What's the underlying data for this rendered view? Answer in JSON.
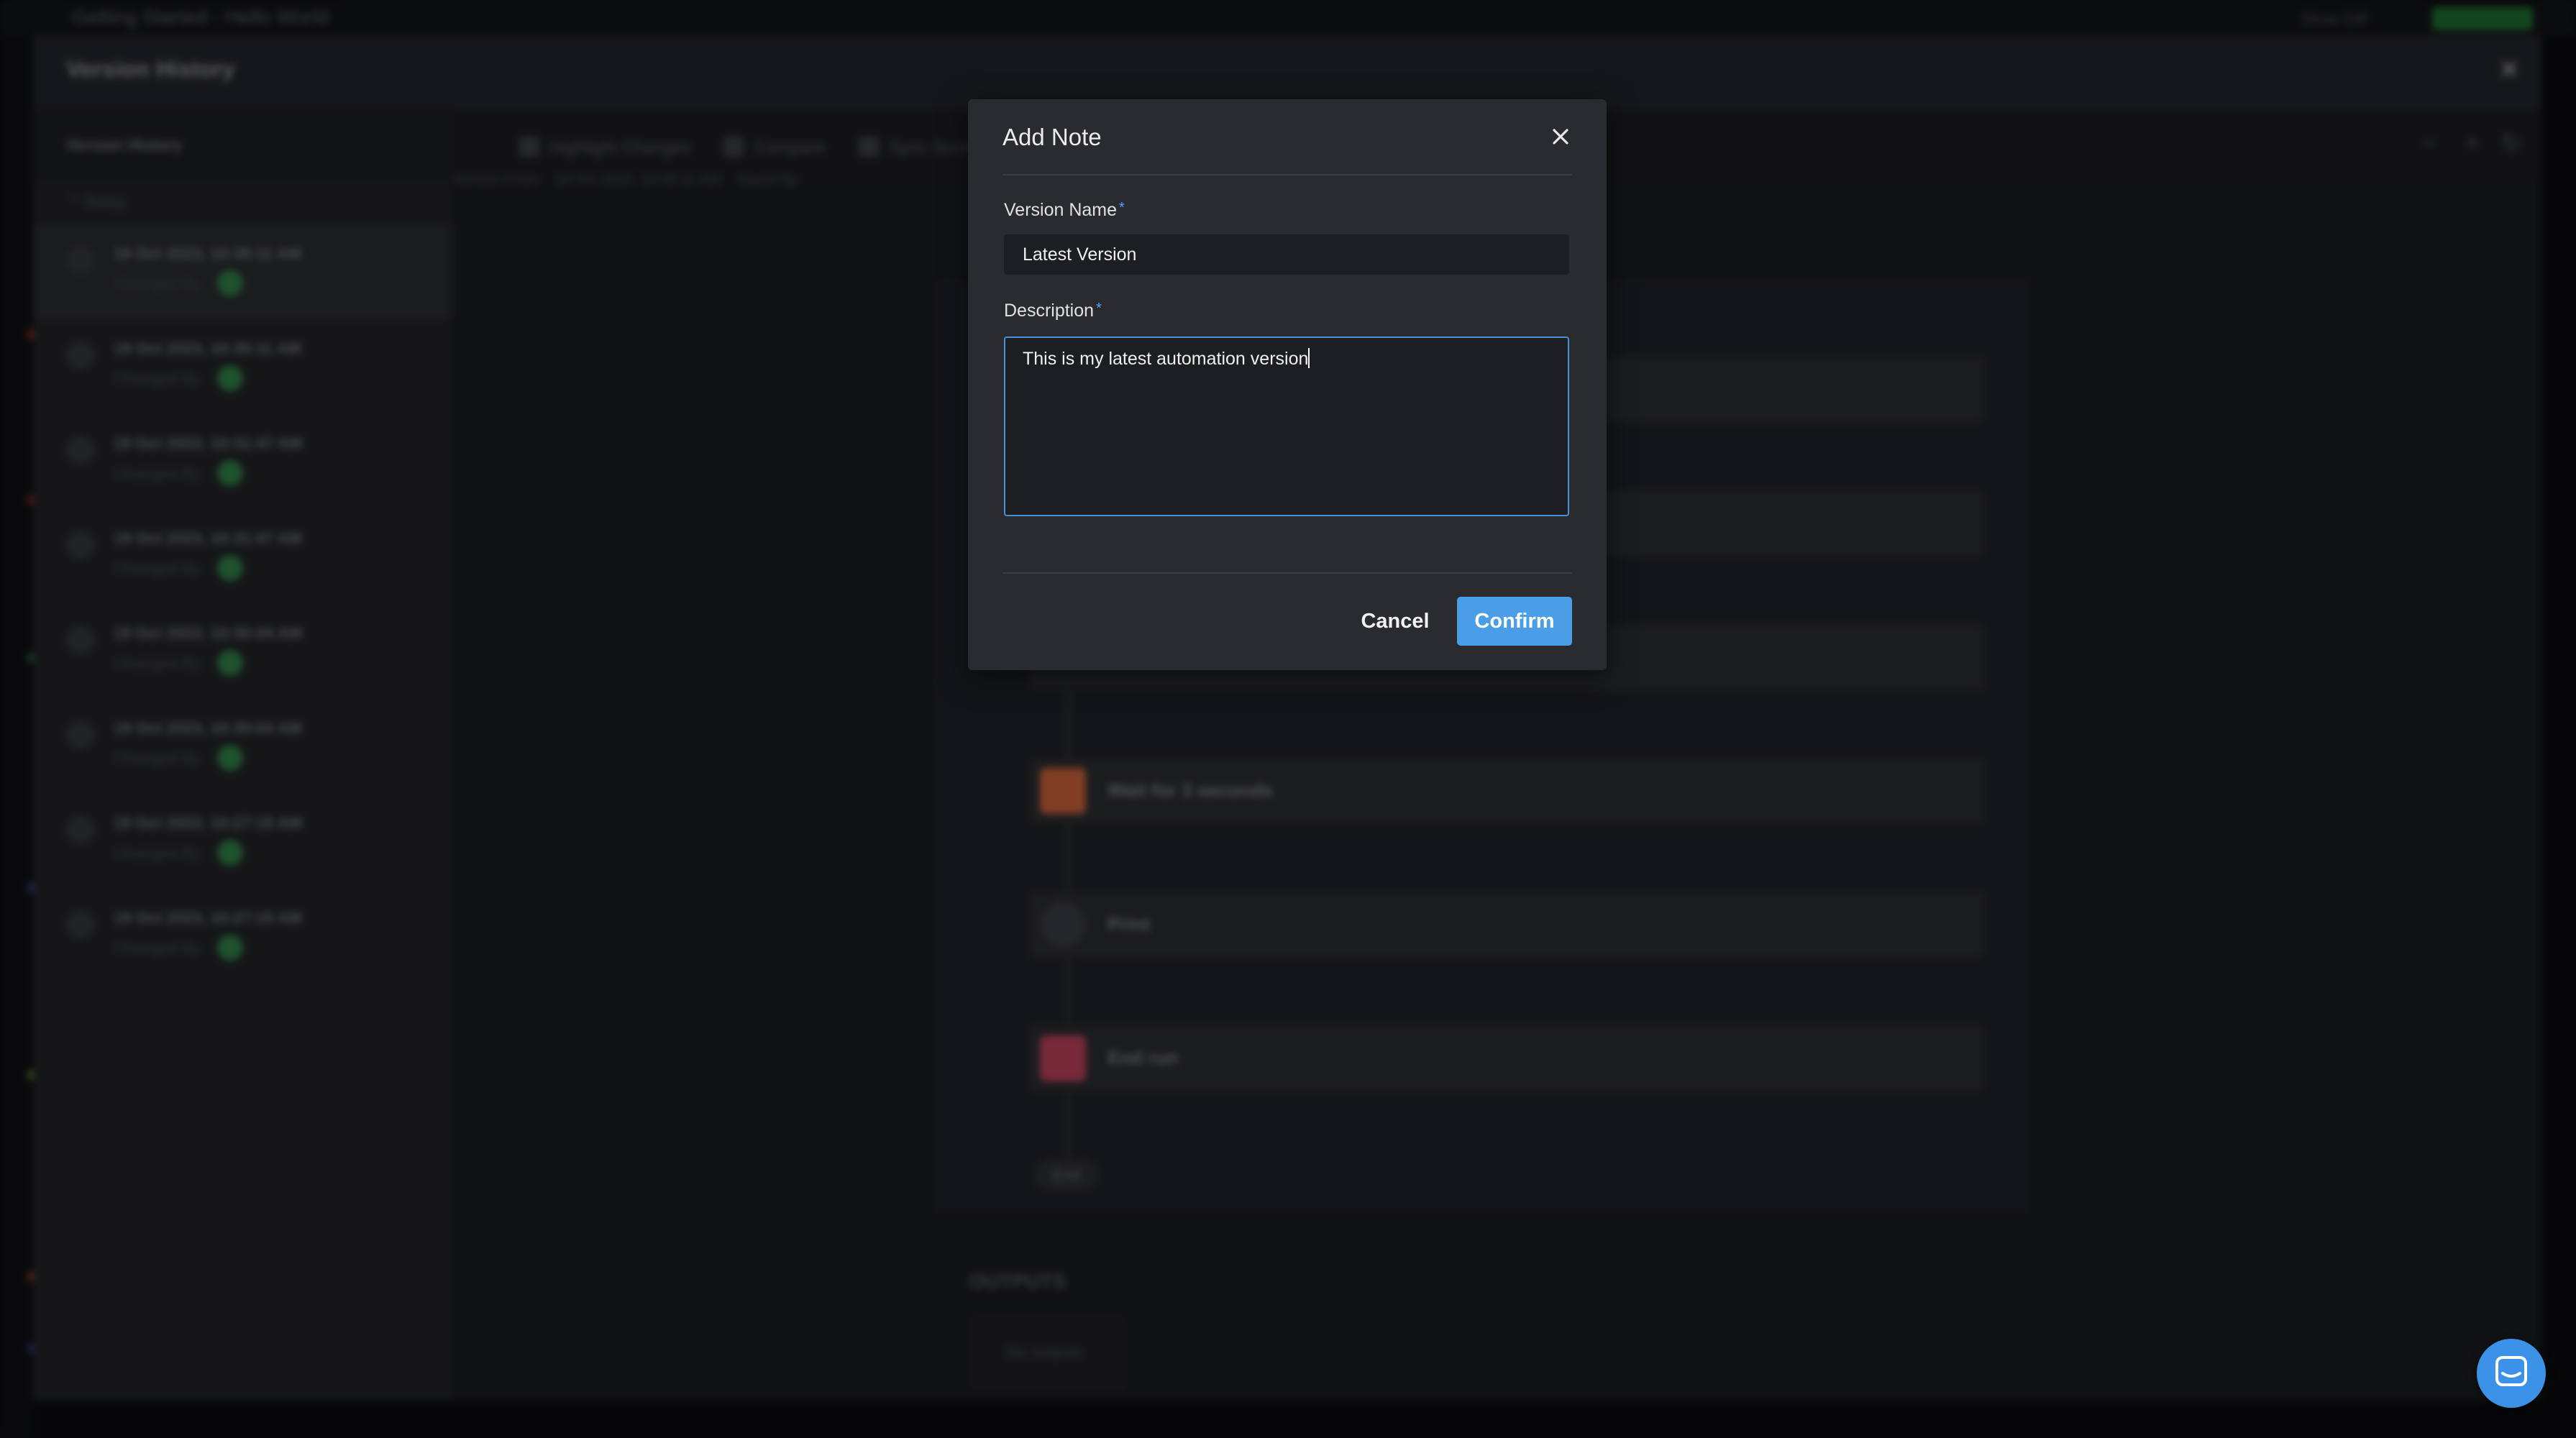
{
  "background": {
    "app_title": "Getting Started - Hello World",
    "top_right_text": "Show Diff",
    "panel_title": "Version History",
    "sidebar_header": "Version History",
    "today_label": "Today",
    "versions": [
      {
        "date": "19 Oct 2023, 10:35:11 AM",
        "changed_by": "Changed By"
      },
      {
        "date": "19 Oct 2023, 10:35:11 AM",
        "changed_by": "Changed By"
      },
      {
        "date": "19 Oct 2023, 10:31:47 AM",
        "changed_by": "Changed By"
      },
      {
        "date": "19 Oct 2023, 10:31:47 AM",
        "changed_by": "Changed By"
      },
      {
        "date": "19 Oct 2023, 10:30:04 AM",
        "changed_by": "Changed By"
      },
      {
        "date": "19 Oct 2023, 10:30:04 AM",
        "changed_by": "Changed By"
      },
      {
        "date": "19 Oct 2023, 10:27:15 AM",
        "changed_by": "Changed By"
      },
      {
        "date": "19 Oct 2023, 10:27:15 AM",
        "changed_by": "Changed By"
      }
    ],
    "toolbar": {
      "highlight_changes": "Highlight Changes",
      "compare": "Compare",
      "sync_scrolling": "Sync Scrolling"
    },
    "meta": {
      "version_from": "Version From",
      "version_date": "19 Oct 2023, 10:35:11 AM",
      "saved_by": "Saved By"
    },
    "nodes": {
      "wait": "Wait  for  3  seconds",
      "print": "Print",
      "end_run": "End run"
    },
    "end_label": "End",
    "outputs_label": "OUTPUTS",
    "no_outputs": "No outputs"
  },
  "modal": {
    "title": "Add Note",
    "version_name_label": "Version Name",
    "version_name_value": "Latest Version",
    "description_label": "Description",
    "description_value": "This is my latest automation version",
    "required_marker": "*",
    "cancel_label": "Cancel",
    "confirm_label": "Confirm"
  },
  "colors": {
    "accent": "#4a9ee8",
    "focus_border": "#4a90d9",
    "modal_bg": "#2a2b2e",
    "input_bg": "#1d1e21",
    "avatar_green": "#2f7d44"
  },
  "icons": [
    "close-icon",
    "chat-icon",
    "wait-icon",
    "print-eye-icon",
    "end-run-icon",
    "checkbox-icon",
    "zoom-out-icon",
    "zoom-in-icon",
    "reset-icon"
  ]
}
